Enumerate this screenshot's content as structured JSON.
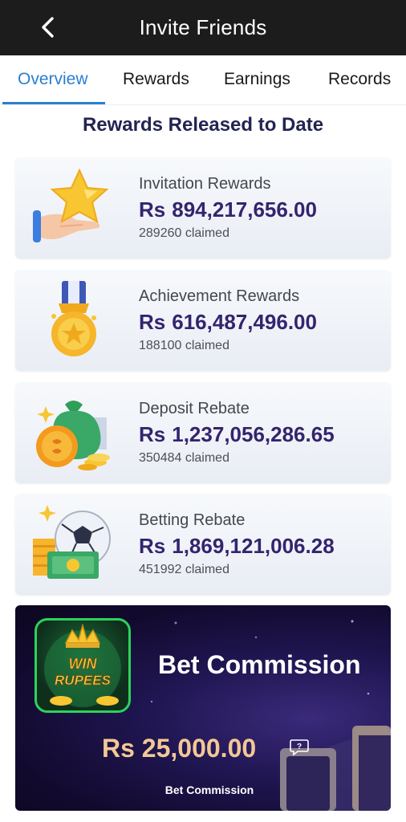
{
  "header": {
    "title": "Invite Friends"
  },
  "tabs": [
    {
      "label": "Overview",
      "active": true
    },
    {
      "label": "Rewards",
      "active": false
    },
    {
      "label": "Earnings",
      "active": false
    },
    {
      "label": "Records",
      "active": false
    }
  ],
  "section_title": "Rewards Released to Date",
  "cards": [
    {
      "label": "Invitation Rewards",
      "currency": "Rs",
      "amount": "894,217,656.00",
      "claimed": "289260 claimed",
      "icon": "star-hand-icon"
    },
    {
      "label": "Achievement Rewards",
      "currency": "Rs",
      "amount": "616,487,496.00",
      "claimed": "188100 claimed",
      "icon": "medal-icon"
    },
    {
      "label": "Deposit Rebate",
      "currency": "Rs",
      "amount": "1,237,056,286.65",
      "claimed": "350484 claimed",
      "icon": "money-bag-icon"
    },
    {
      "label": "Betting Rebate",
      "currency": "Rs",
      "amount": "1,869,121,006.28",
      "claimed": "451992 claimed",
      "icon": "football-cash-icon"
    }
  ],
  "banner": {
    "logo_line1": "WIN",
    "logo_line2": "RUPEES",
    "title": "Bet Commission",
    "amount": "Rs 25,000.00",
    "subtitle": "Bet Commission"
  },
  "colors": {
    "accent": "#2a7fd0",
    "amount": "#34246e",
    "banner_amount": "#f3c896",
    "header_bg": "#1c1c1c"
  }
}
